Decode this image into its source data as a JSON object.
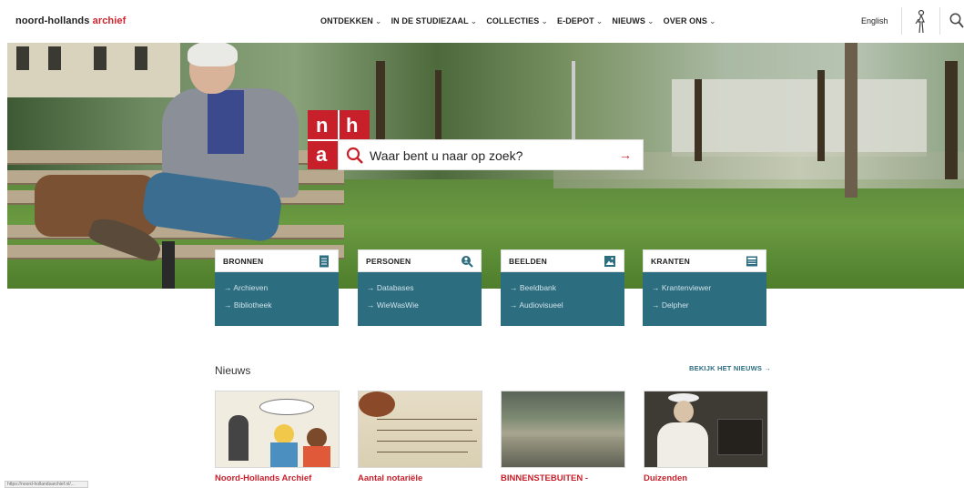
{
  "header": {
    "brand_main": "noord-hollands ",
    "brand_accent": "archief",
    "nav": [
      {
        "label": "ONTDEKKEN",
        "chev": "⌄"
      },
      {
        "label": "IN DE STUDIEZAAL",
        "chev": "⌄"
      },
      {
        "label": "COLLECTIES",
        "chev": "⌄"
      },
      {
        "label": "E-DEPOT",
        "chev": "⌄"
      },
      {
        "label": "NIEUWS",
        "chev": "⌄"
      },
      {
        "label": "OVER ONS",
        "chev": "⌄"
      }
    ],
    "language": "English"
  },
  "search": {
    "logo": {
      "n": "n",
      "h": "h",
      "a": "a"
    },
    "placeholder": "Waar bent u naar op zoek?",
    "submit_glyph": "→"
  },
  "cards": [
    {
      "title": "BRONNEN",
      "icon": "book-icon",
      "links": [
        "→ Archieven",
        "→ Bibliotheek"
      ]
    },
    {
      "title": "PERSONEN",
      "icon": "person-search-icon",
      "links": [
        "→ Databases",
        "→ WieWasWie"
      ]
    },
    {
      "title": "BEELDEN",
      "icon": "image-icon",
      "links": [
        "→ Beeldbank",
        "→ Audiovisueel"
      ]
    },
    {
      "title": "KRANTEN",
      "icon": "newspaper-icon",
      "links": [
        "→ Krantenviewer",
        "→ Delpher"
      ]
    }
  ],
  "news": {
    "title": "Nieuws",
    "more_link": "BEKIJK HET NIEUWS →",
    "items": [
      {
        "caption": "Noord-Hollands Archief",
        "image": "comic-illustration"
      },
      {
        "caption": "Aantal notariële",
        "image": "handwritten-document"
      },
      {
        "caption": "BINNENSTEBUITEN -",
        "image": "historic-city-photo"
      },
      {
        "caption": "Duizenden",
        "image": "vintage-portrait"
      }
    ]
  },
  "status_bar": "https://noord-hollandsarchief.nl/...",
  "colors": {
    "brand_red": "#c8202b",
    "card_teal": "#2d6d80"
  }
}
